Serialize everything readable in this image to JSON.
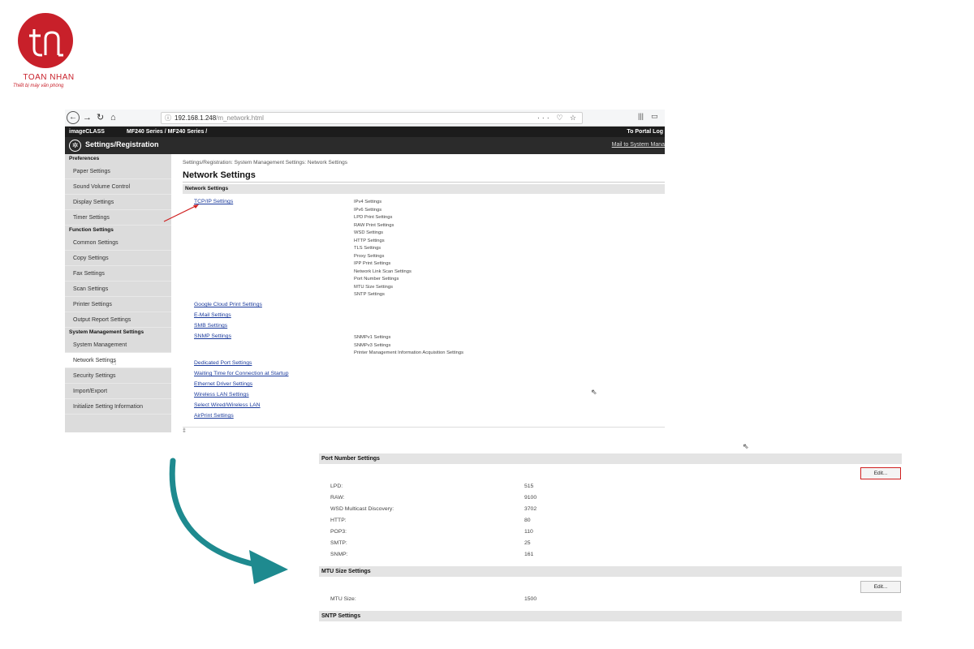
{
  "logo": {
    "name": "TOAN NHAN",
    "tagline": "Thiết bị máy văn phòng"
  },
  "browser": {
    "url_host": "192.168.1.248",
    "url_path": "/m_network.html",
    "url_menu": "···",
    "brand": "imageCLASS",
    "model": "MF240 Series / MF240 Series /",
    "top_links": "To Portal  Log",
    "title": "Settings/Registration",
    "mail_link": "Mail to System Mana"
  },
  "sidebar": {
    "sections": [
      {
        "heading": "Preferences",
        "items": [
          "Paper Settings",
          "Sound Volume Control",
          "Display Settings",
          "Timer Settings"
        ]
      },
      {
        "heading": "Function Settings",
        "items": [
          "Common Settings",
          "Copy Settings",
          "Fax Settings",
          "Scan Settings",
          "Printer Settings",
          "Output Report Settings"
        ]
      },
      {
        "heading": "System Management Settings",
        "items": [
          "System Management",
          "Network Settings",
          "Security Settings",
          "Import/Export",
          "Initialize Setting Information"
        ]
      }
    ],
    "active_item": "Network Settings"
  },
  "content": {
    "breadcrumb": "Settings/Registration: System Management Settings: Network Settings",
    "page_title": "Network Settings",
    "section": "Network Settings",
    "links": [
      "TCP/IP Settings",
      "Google Cloud Print Settings",
      "E-Mail Settings",
      "SMB Settings",
      "SNMP Settings",
      "Dedicated Port Settings",
      "Waiting Time for Connection at Startup",
      "Ethernet Driver Settings",
      "Wireless LAN Settings",
      "Select Wired/Wireless LAN",
      "AirPrint Settings"
    ],
    "tcpip_sub": [
      "IPv4 Settings",
      "IPv6 Settings",
      "LPD Print Settings",
      "RAW Print Settings",
      "WSD Settings",
      "HTTP Settings",
      "TLS Settings",
      "Proxy Settings",
      "IPP Print Settings",
      "Network Link Scan Settings",
      "Port Number Settings",
      "MTU Size Settings",
      "SNTP Settings"
    ],
    "snmp_sub": [
      "SNMPv1 Settings",
      "SNMPv3 Settings",
      "Printer Management Information Acquisition Settings"
    ]
  },
  "panel": {
    "port_section": "Port Number Settings",
    "edit_label": "Edit...",
    "ports": [
      {
        "label": "LPD:",
        "value": "515"
      },
      {
        "label": "RAW:",
        "value": "9100"
      },
      {
        "label": "WSD Multicast Discovery:",
        "value": "3702"
      },
      {
        "label": "HTTP:",
        "value": "80"
      },
      {
        "label": "POP3:",
        "value": "110"
      },
      {
        "label": "SMTP:",
        "value": "25"
      },
      {
        "label": "SNMP:",
        "value": "161"
      }
    ],
    "mtu_section": "MTU Size Settings",
    "mtu_label": "MTU Size:",
    "mtu_value": "1500",
    "sntp_section": "SNTP Settings"
  },
  "colors": {
    "logo_red": "#c8202a",
    "highlight_red": "#d02020",
    "arrow_teal": "#1e8a8f",
    "link_blue": "#1a3a9c"
  }
}
